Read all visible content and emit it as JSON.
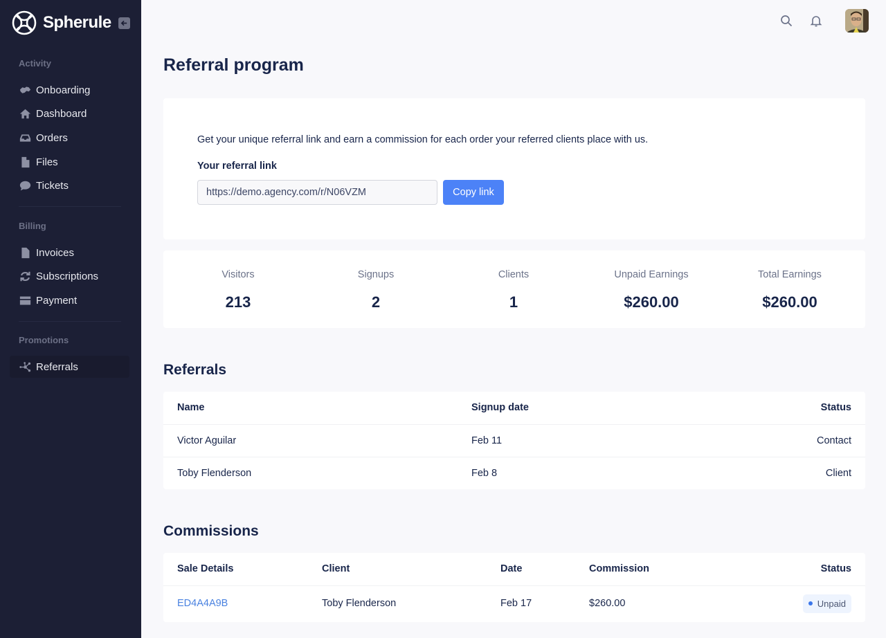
{
  "app": {
    "brand": "Spherule"
  },
  "sidebar": {
    "sections": [
      {
        "label": "Activity",
        "items": [
          {
            "label": "Onboarding",
            "icon": "handshake-icon"
          },
          {
            "label": "Dashboard",
            "icon": "home-icon"
          },
          {
            "label": "Orders",
            "icon": "inbox-icon"
          },
          {
            "label": "Files",
            "icon": "file-icon"
          },
          {
            "label": "Tickets",
            "icon": "chat-bubble-icon"
          }
        ]
      },
      {
        "label": "Billing",
        "items": [
          {
            "label": "Invoices",
            "icon": "invoice-icon"
          },
          {
            "label": "Subscriptions",
            "icon": "refresh-icon"
          },
          {
            "label": "Payment",
            "icon": "credit-card-icon"
          }
        ]
      },
      {
        "label": "Promotions",
        "items": [
          {
            "label": "Referrals",
            "icon": "network-icon",
            "active": true
          }
        ]
      }
    ]
  },
  "page": {
    "title": "Referral program",
    "intro": "Get your unique referral link and earn a commission for each order your referred clients place with us.",
    "link_label": "Your referral link",
    "link_value": "https://demo.agency.com/r/N06VZM",
    "copy_label": "Copy link"
  },
  "stats": [
    {
      "label": "Visitors",
      "value": "213"
    },
    {
      "label": "Signups",
      "value": "2"
    },
    {
      "label": "Clients",
      "value": "1"
    },
    {
      "label": "Unpaid Earnings",
      "value": "$260.00"
    },
    {
      "label": "Total Earnings",
      "value": "$260.00"
    }
  ],
  "referrals": {
    "title": "Referrals",
    "columns": [
      "Name",
      "Signup date",
      "Status"
    ],
    "rows": [
      {
        "name": "Victor Aguilar",
        "date": "Feb 11",
        "status": "Contact"
      },
      {
        "name": "Toby Flenderson",
        "date": "Feb 8",
        "status": "Client"
      }
    ]
  },
  "commissions": {
    "title": "Commissions",
    "columns": [
      "Sale Details",
      "Client",
      "Date",
      "Commission",
      "Status"
    ],
    "rows": [
      {
        "sale": "ED4A4A9B",
        "client": "Toby Flenderson",
        "date": "Feb 17",
        "commission": "$260.00",
        "status": "Unpaid"
      }
    ]
  },
  "colors": {
    "sidebar_bg": "#1c1f35",
    "accent": "#4c82f7",
    "text": "#18254a"
  }
}
